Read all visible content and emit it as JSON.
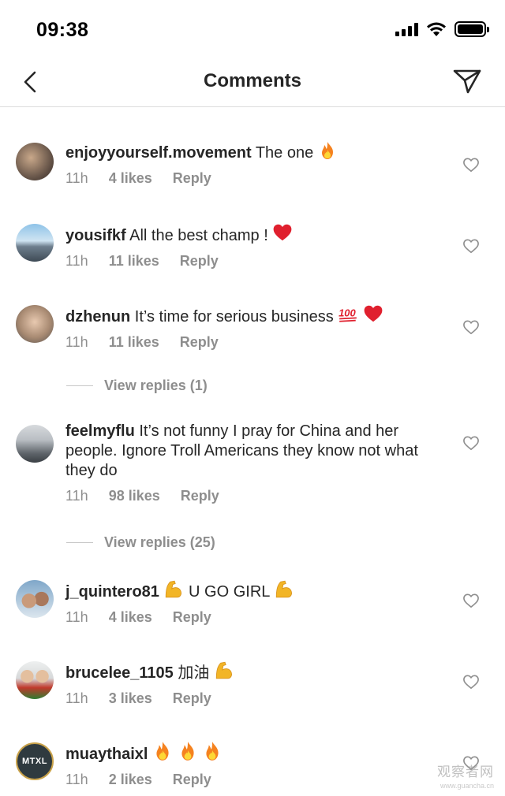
{
  "status": {
    "time": "09:38"
  },
  "nav": {
    "title": "Comments"
  },
  "comments": [
    {
      "username": "enjoyyourself.movement",
      "text": "The one",
      "emoji": [
        "fire"
      ],
      "time": "11h",
      "likes": "4 likes",
      "reply": "Reply"
    },
    {
      "username": "yousifkf",
      "text": "All the best champ !",
      "emoji": [
        "heart"
      ],
      "time": "11h",
      "likes": "11 likes",
      "reply": "Reply"
    },
    {
      "username": "dzhenun",
      "text": "It’s time for serious business",
      "emoji": [
        "hundred",
        "heart"
      ],
      "time": "11h",
      "likes": "11 likes",
      "reply": "Reply",
      "view_replies": "View replies (1)"
    },
    {
      "username": "feelmyflu",
      "text": "It’s not funny I pray for China and her people. Ignore Troll Americans they know not what they do",
      "emoji": [],
      "time": "11h",
      "likes": "98 likes",
      "reply": "Reply",
      "view_replies": "View replies (25)"
    },
    {
      "username": "j_quintero81",
      "text": "U GO GIRL",
      "emoji": [
        "muscle-before",
        "muscle"
      ],
      "time": "11h",
      "likes": "4 likes",
      "reply": "Reply"
    },
    {
      "username": "brucelee_1105",
      "text": "加油",
      "emoji": [
        "muscle"
      ],
      "time": "11h",
      "likes": "3 likes",
      "reply": "Reply"
    },
    {
      "username": "muaythaixl",
      "text": "",
      "emoji": [
        "fire",
        "fire",
        "fire"
      ],
      "time": "11h",
      "likes": "2 likes",
      "reply": "Reply",
      "avatar_label": "MTXL"
    }
  ],
  "watermark": {
    "text": "观察者网",
    "sub": "www.guancha.cn"
  },
  "colors": {
    "text": "#262626",
    "muted": "#8e8e8e",
    "divider": "#dbdbdb",
    "fire": "#f5821f",
    "heart": "#e0202e",
    "muscle": "#f2b526"
  }
}
